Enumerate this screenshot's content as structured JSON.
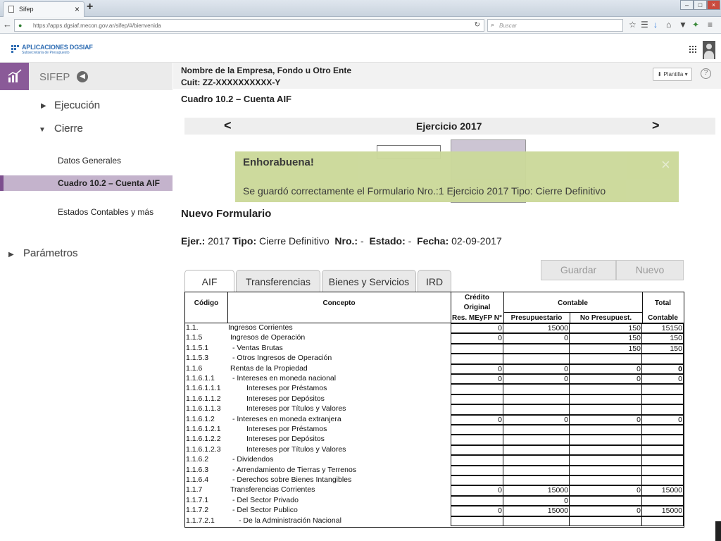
{
  "browser": {
    "tab_title": "Sifep",
    "tab_close": "×",
    "new_tab": "+",
    "url": "https://apps.dgsiaf.mecon.gov.ar/sifep/#/bienvenida",
    "search_placeholder": "Buscar",
    "window_controls": [
      "–",
      "□",
      "×"
    ]
  },
  "app": {
    "logo_title": "APLICACIONES DGSIAF",
    "logo_subtitle": "Subsecretaría de Presupuesto"
  },
  "sidebar": {
    "title": "SIFEP",
    "items": [
      {
        "label": "Ejecución",
        "expanded": false
      },
      {
        "label": "Cierre",
        "expanded": true
      },
      {
        "label": "Parámetros",
        "expanded": false
      }
    ],
    "subitems": [
      {
        "label": "Datos Generales",
        "active": false
      },
      {
        "label": "Cuadro 10.2  – Cuenta AIF",
        "active": true
      },
      {
        "label": "Estados Contables y más",
        "active": false
      }
    ]
  },
  "header": {
    "company": "Nombre de la Empresa, Fondo u Otro Ente",
    "cuit": "Cuit: ZZ-XXXXXXXXXX-Y",
    "cuadro": "Cuadro 10.2  – Cuenta AIF",
    "plantilla_button": "Plantilla"
  },
  "year_nav": {
    "prev": "<",
    "label": "Ejercicio 2017",
    "next": ">"
  },
  "alert": {
    "title": "Enhorabuena!",
    "message": "Se guardó correctamente el Formulario Nro.:1 Ejercicio 2017  Tipo: Cierre Definitivo",
    "close": "×"
  },
  "form": {
    "title": "Nuevo Formulario",
    "ejer_label": "Ejer.:",
    "ejer_value": "2017",
    "tipo_label": "Tipo:",
    "tipo_value": "Cierre Definitivo",
    "nro_label": "Nro.:",
    "nro_value": "-",
    "estado_label": "Estado:",
    "estado_value": "-",
    "fecha_label": "Fecha:",
    "fecha_value": "02-09-2017"
  },
  "actions": {
    "save": "Guardar",
    "new": "Nuevo"
  },
  "tabs": [
    "AIF",
    "Transferencias",
    "Bienes y Servicios",
    "IRD"
  ],
  "table": {
    "headers": {
      "codigo": "Código",
      "concepto": "Concepto",
      "credito_1": "Crédito",
      "credito_2": "Original",
      "credito_3": "Res. MEyFP N°",
      "contable": "Contable",
      "presupuestario": "Presupuestario",
      "no_presupuest": "No Presupuest.",
      "total_1": "Total",
      "total_2": "Contable"
    },
    "rows": [
      {
        "code": "1.1.",
        "concept": "Ingresos Corrientes",
        "indent": 0,
        "v": [
          "0",
          "15000",
          "150",
          "15150"
        ]
      },
      {
        "code": "1.1.5",
        "concept": "Ingresos de Operación",
        "indent": 1,
        "v": [
          "0",
          "0",
          "150",
          "150"
        ]
      },
      {
        "code": "1.1.5.1",
        "concept": "- Ventas Brutas",
        "indent": 2,
        "v": [
          "",
          "",
          "150",
          "150"
        ]
      },
      {
        "code": "1.1.5.3",
        "concept": "- Otros Ingresos de Operación",
        "indent": 2,
        "v": [
          "",
          "",
          "",
          ""
        ]
      },
      {
        "code": "1.1.6",
        "concept": "Rentas de la Propiedad",
        "indent": 1,
        "v": [
          "0",
          "0",
          "0",
          "0"
        ]
      },
      {
        "code": "1.1.6.1.1",
        "concept": "- Intereses en moneda nacional",
        "indent": 2,
        "v": [
          "0",
          "0",
          "0",
          "0"
        ]
      },
      {
        "code": "1.1.6.1.1.1",
        "concept": "Intereses por Préstamos",
        "indent": 3,
        "v": [
          "",
          "",
          "",
          ""
        ]
      },
      {
        "code": "1.1.6.1.1.2",
        "concept": "Intereses por Depósitos",
        "indent": 3,
        "v": [
          "",
          "",
          "",
          ""
        ]
      },
      {
        "code": "1.1.6.1.1.3",
        "concept": "Intereses por Títulos y Valores",
        "indent": 3,
        "v": [
          "",
          "",
          "",
          ""
        ]
      },
      {
        "code": "1.1.6.1.2",
        "concept": "- Intereses en moneda extranjera",
        "indent": 2,
        "v": [
          "0",
          "0",
          "0",
          "0"
        ]
      },
      {
        "code": "1.1.6.1.2.1",
        "concept": "Intereses por Préstamos",
        "indent": 3,
        "v": [
          "",
          "",
          "",
          ""
        ]
      },
      {
        "code": "1.1.6.1.2.2",
        "concept": "Intereses por Depósitos",
        "indent": 3,
        "v": [
          "",
          "",
          "",
          ""
        ]
      },
      {
        "code": "1.1.6.1.2.3",
        "concept": "Intereses por Títulos y Valores",
        "indent": 3,
        "v": [
          "",
          "",
          "",
          ""
        ]
      },
      {
        "code": "1.1.6.2",
        "concept": "- Dividendos",
        "indent": 2,
        "v": [
          "",
          "",
          "",
          ""
        ]
      },
      {
        "code": "1.1.6.3",
        "concept": "- Arrendamiento de Tierras y Terrenos",
        "indent": 2,
        "v": [
          "",
          "",
          "",
          ""
        ]
      },
      {
        "code": "1.1.6.4",
        "concept": "- Derechos sobre Bienes Intangibles",
        "indent": 2,
        "v": [
          "",
          "",
          "",
          ""
        ]
      },
      {
        "code": "1.1.7",
        "concept": "Transferencias Corrientes",
        "indent": 1,
        "v": [
          "0",
          "15000",
          "0",
          "15000"
        ]
      },
      {
        "code": "1.1.7.1",
        "concept": "- Del Sector Privado",
        "indent": 2,
        "v": [
          "",
          "0",
          "",
          ""
        ]
      },
      {
        "code": "1.1.7.2",
        "concept": "- Del Sector Publico",
        "indent": 2,
        "v": [
          "0",
          "15000",
          "0",
          "15000"
        ]
      },
      {
        "code": "1.1.7.2.1",
        "concept": "- De la Administración Nacional",
        "indent": 2.6,
        "v": [
          "",
          "",
          "",
          ""
        ]
      }
    ]
  }
}
